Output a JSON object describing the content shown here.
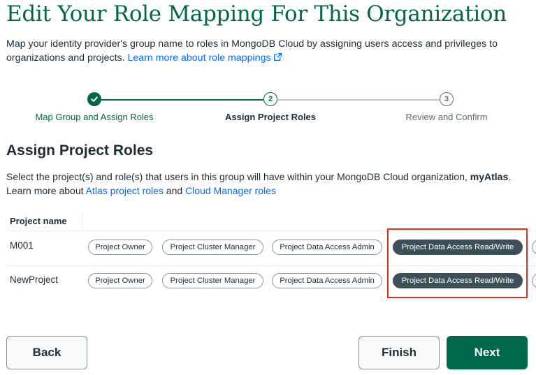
{
  "page": {
    "title": "Edit Your Role Mapping For This Organization",
    "intro_text": "Map your identity provider's group name to roles in MongoDB Cloud by assigning users access and privileges to organizations and projects. ",
    "intro_link": "Learn more about role mappings"
  },
  "stepper": {
    "steps": [
      {
        "number": "1",
        "label": "Map Group and Assign Roles",
        "state": "complete"
      },
      {
        "number": "2",
        "label": "Assign Project Roles",
        "state": "current"
      },
      {
        "number": "3",
        "label": "Review and Confirm",
        "state": "upcoming"
      }
    ]
  },
  "section": {
    "heading": "Assign Project Roles",
    "desc_text": "Select the project(s) and role(s) that users in this group will have within your MongoDB Cloud organization, ",
    "org_name": "myAtlas",
    "desc_end": ".",
    "learn_text": "Learn more about ",
    "atlas_link": "Atlas project roles",
    "and_text": " and ",
    "cloud_link": "Cloud Manager roles"
  },
  "table": {
    "header_project": "Project name",
    "rows": [
      {
        "name": "M001",
        "roles": [
          {
            "label": "Project Owner",
            "selected": false
          },
          {
            "label": "Project Cluster Manager",
            "selected": false
          },
          {
            "label": "Project Data Access Admin",
            "selected": false
          },
          {
            "label": "Project Data Access Read/Write",
            "selected": true
          }
        ]
      },
      {
        "name": "NewProject",
        "roles": [
          {
            "label": "Project Owner",
            "selected": false
          },
          {
            "label": "Project Cluster Manager",
            "selected": false
          },
          {
            "label": "Project Data Access Admin",
            "selected": false
          },
          {
            "label": "Project Data Access Read/Write",
            "selected": true
          }
        ]
      }
    ]
  },
  "footer": {
    "back_label": "Back",
    "finish_label": "Finish",
    "next_label": "Next"
  },
  "colors": {
    "brand_green": "#00684a",
    "link_blue": "#016bf8",
    "selected_chip": "#3d4f58",
    "highlight_red": "#e2331f"
  },
  "icons": {
    "external_link": "external-link-icon",
    "step_complete": "check-icon"
  }
}
